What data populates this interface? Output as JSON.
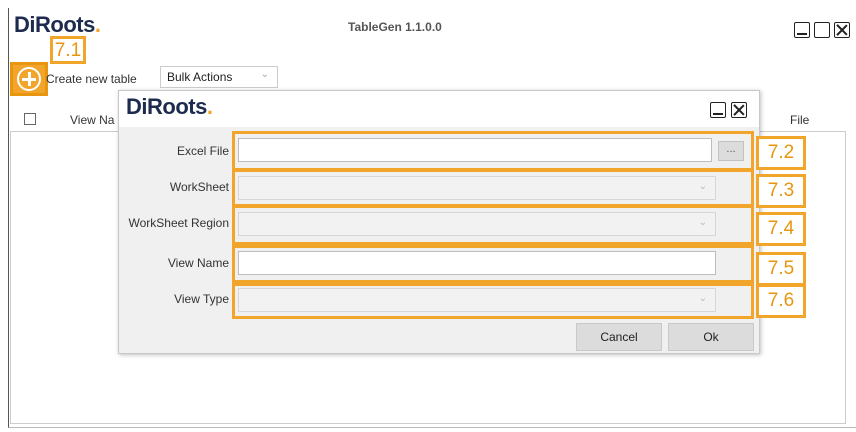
{
  "app": {
    "logo_main": "DiRoots",
    "logo_dot": ".",
    "title": "TableGen 1.1.0.0"
  },
  "toolbar": {
    "create_label": "Create new table",
    "bulk_actions": "Bulk Actions",
    "chevron": "⌄"
  },
  "grid": {
    "columns": [
      "View Na",
      "File"
    ]
  },
  "dialog": {
    "logo_main": "DiRoots",
    "logo_dot": ".",
    "fields": [
      {
        "label": "Excel File",
        "value": "",
        "browse_label": "..."
      },
      {
        "label": "WorkSheet",
        "value": ""
      },
      {
        "label": "WorkSheet Region",
        "value": ""
      },
      {
        "label": "View Name",
        "value": ""
      },
      {
        "label": "View Type",
        "value": ""
      }
    ],
    "cancel_label": "Cancel",
    "ok_label": "Ok"
  },
  "callouts": [
    "7.1",
    "7.2",
    "7.3",
    "7.4",
    "7.5",
    "7.6"
  ],
  "colors": {
    "accent": "#f2a52b",
    "logo": "#1d2b4f"
  },
  "icons": {
    "add": "add-circle-icon",
    "minimize": "minimize-icon",
    "close": "close-icon",
    "dropdown": "chevron-down-icon"
  }
}
